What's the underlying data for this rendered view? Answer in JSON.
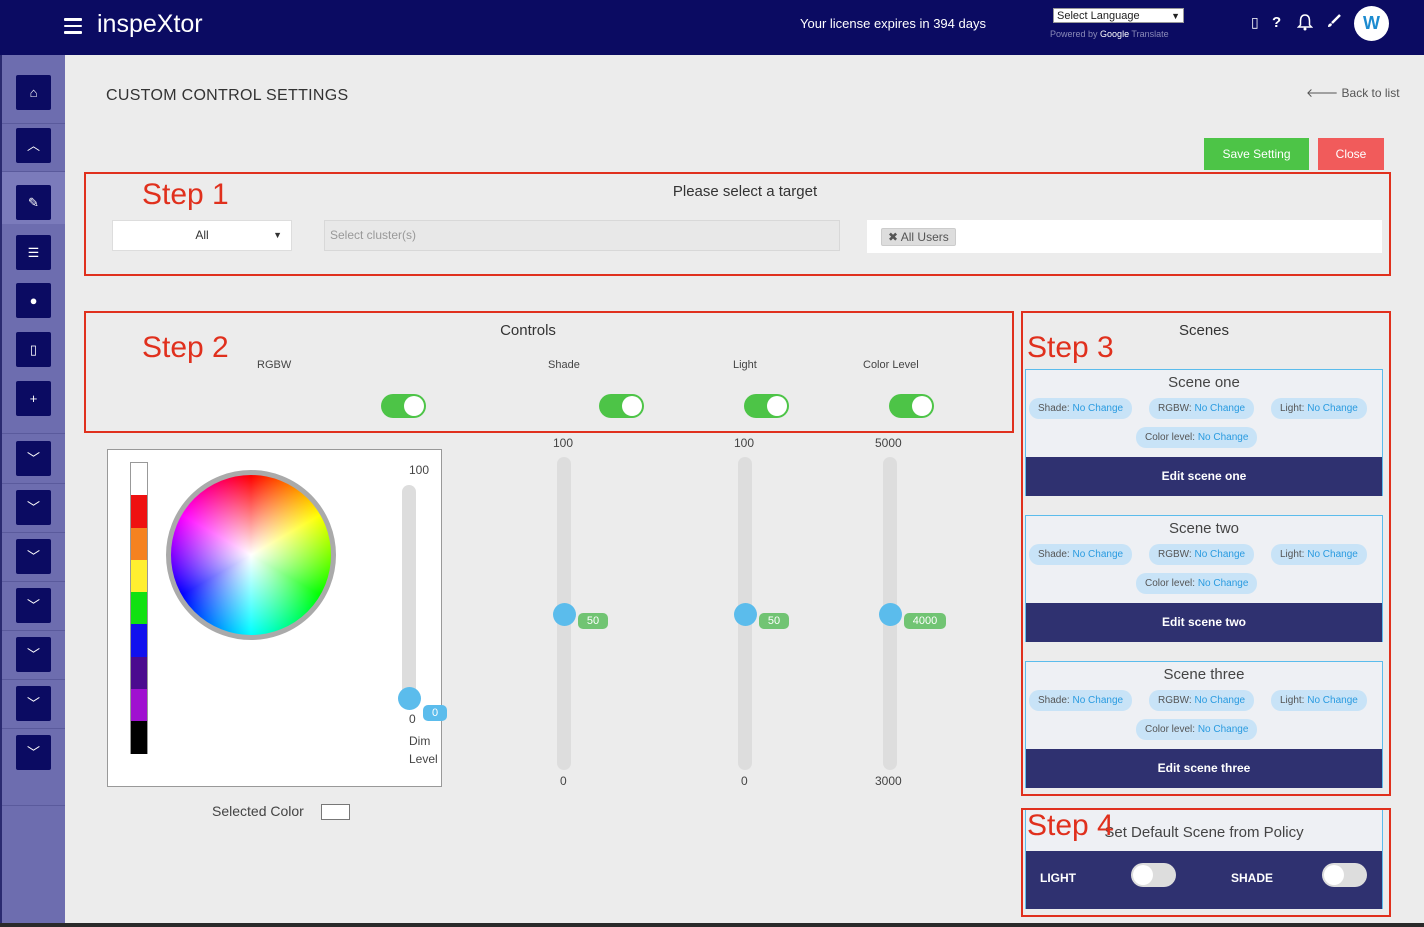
{
  "header": {
    "brand": "inspeXtor",
    "license_text": "Your license expires in 394 days",
    "language_select": "Select Language",
    "powered_by": "Powered by",
    "google": "Google",
    "translate": "Translate",
    "avatar_text": "W"
  },
  "page": {
    "title": "CUSTOM CONTROL SETTINGS",
    "back_link": "Back to list",
    "save_button": "Save Setting",
    "close_button": "Close"
  },
  "steps": {
    "step1": "Step 1",
    "step2": "Step 2",
    "step3": "Step 3",
    "step4": "Step 4"
  },
  "target": {
    "title": "Please select a target",
    "select_value": "All",
    "cluster_placeholder": "Select cluster(s)",
    "user_tag": "All Users"
  },
  "controls": {
    "title": "Controls",
    "labels": [
      "RGBW",
      "Shade",
      "Light",
      "Color Level"
    ],
    "toggles_on": [
      true,
      true,
      true,
      true
    ]
  },
  "color_picker": {
    "palette": [
      "#ffffff",
      "#ee1111",
      "#f58220",
      "#ffef30",
      "#11e111",
      "#1111ee",
      "#4b0b8f",
      "#a010d0",
      "#000000"
    ],
    "dim_max": "100",
    "dim_min": "0",
    "dim_value": "0",
    "dim_value_num": 0,
    "dim_label_1": "Dim",
    "dim_label_2": "Level",
    "selected_color_label": "Selected Color"
  },
  "sliders": [
    {
      "name": "shade",
      "max": "100",
      "min": "0",
      "value": "50",
      "fraction": 0.5
    },
    {
      "name": "light",
      "max": "100",
      "min": "0",
      "value": "50",
      "fraction": 0.5
    },
    {
      "name": "color-level",
      "max": "5000",
      "min": "3000",
      "value": "4000",
      "fraction": 0.5
    }
  ],
  "scenes": {
    "title": "Scenes",
    "items": [
      {
        "title": "Scene one",
        "edit": "Edit scene one"
      },
      {
        "title": "Scene two",
        "edit": "Edit scene two"
      },
      {
        "title": "Scene three",
        "edit": "Edit scene three"
      }
    ],
    "shade_label": "Shade:",
    "rgbw_label": "RGBW:",
    "light_label": "Light:",
    "color_level_label": "Color level:",
    "no_change": "No Change"
  },
  "default_scene": {
    "title": "Set Default Scene from Policy",
    "light_label": "LIGHT",
    "shade_label": "SHADE",
    "light_on": false,
    "shade_on": false
  }
}
